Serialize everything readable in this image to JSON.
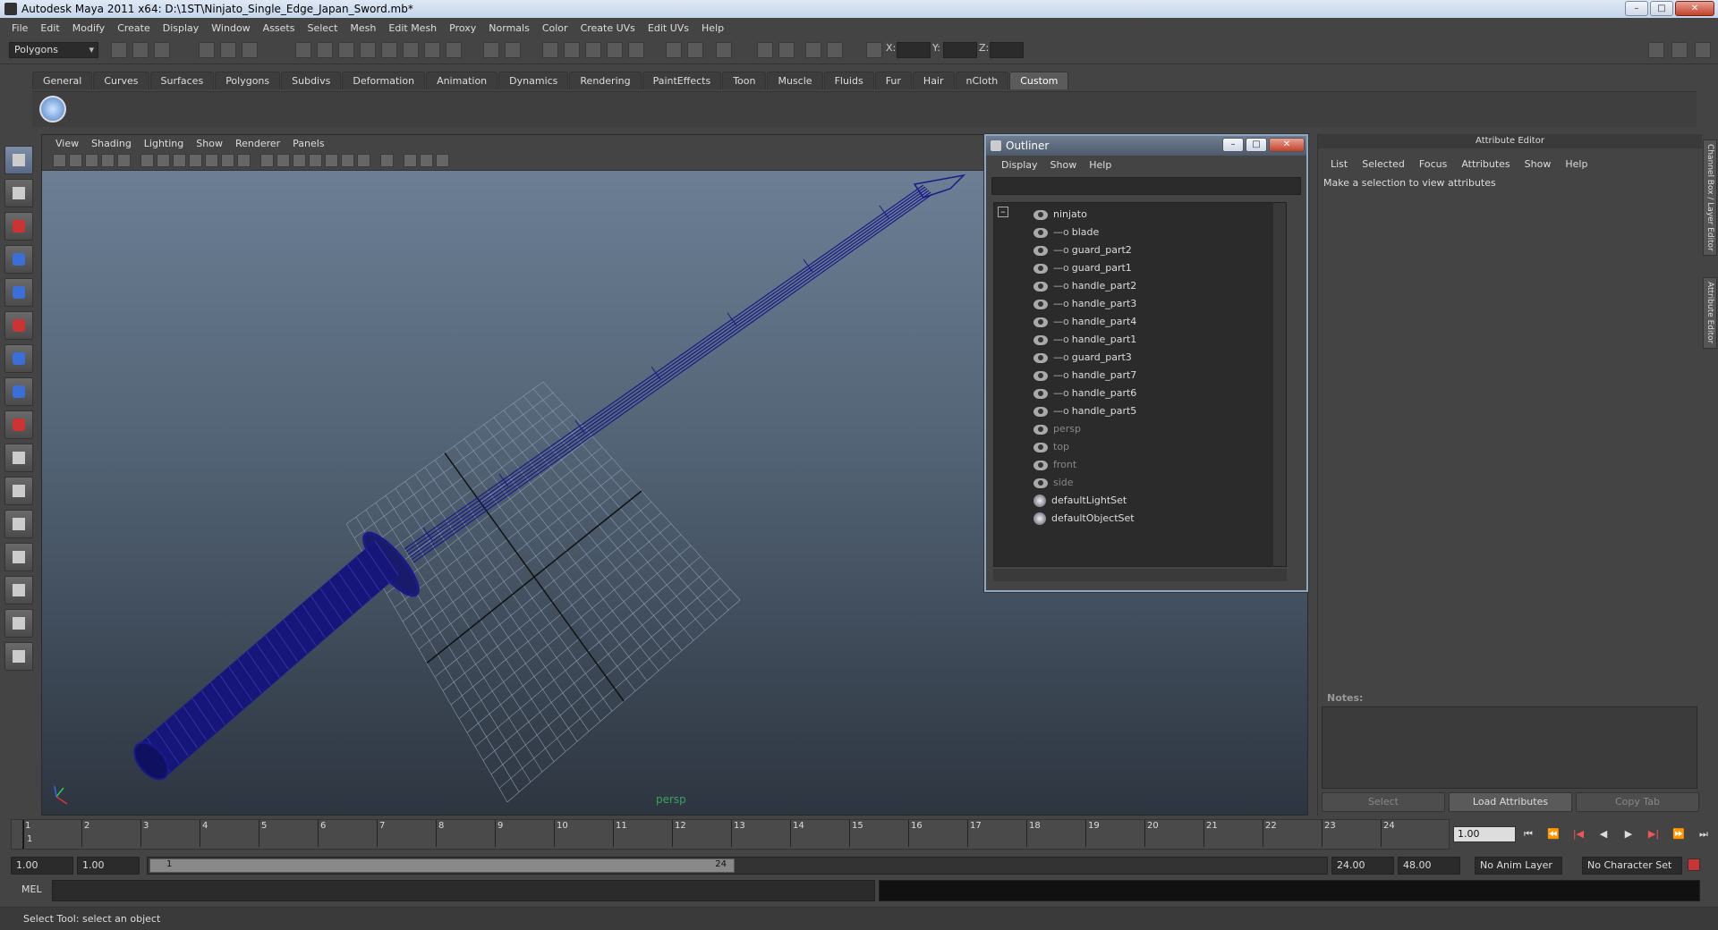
{
  "window": {
    "title": "Autodesk Maya 2011 x64: D:\\1ST\\Ninjato_Single_Edge_Japan_Sword.mb*",
    "minimize": "–",
    "maximize": "□",
    "close": "✕"
  },
  "menubar": [
    "File",
    "Edit",
    "Modify",
    "Create",
    "Display",
    "Window",
    "Assets",
    "Select",
    "Mesh",
    "Edit Mesh",
    "Proxy",
    "Normals",
    "Color",
    "Create UVs",
    "Edit UVs",
    "Help"
  ],
  "statusline": {
    "mode": "Polygons",
    "x_label": "X:",
    "y_label": "Y:",
    "z_label": "Z:"
  },
  "shelf_tabs": [
    "General",
    "Curves",
    "Surfaces",
    "Polygons",
    "Subdivs",
    "Deformation",
    "Animation",
    "Dynamics",
    "Rendering",
    "PaintEffects",
    "Toon",
    "Muscle",
    "Fluids",
    "Fur",
    "Hair",
    "nCloth",
    "Custom"
  ],
  "shelf_active": "Custom",
  "viewport": {
    "menu": [
      "View",
      "Shading",
      "Lighting",
      "Show",
      "Renderer",
      "Panels"
    ],
    "camera": "persp"
  },
  "outliner": {
    "title": "Outliner",
    "menu": [
      "Display",
      "Show",
      "Help"
    ],
    "items": [
      {
        "label": "ninjato",
        "kind": "group",
        "level": 0,
        "dim": false
      },
      {
        "label": "blade",
        "kind": "mesh",
        "level": 1,
        "dim": false
      },
      {
        "label": "guard_part2",
        "kind": "mesh",
        "level": 1,
        "dim": false
      },
      {
        "label": "guard_part1",
        "kind": "mesh",
        "level": 1,
        "dim": false
      },
      {
        "label": "handle_part2",
        "kind": "mesh",
        "level": 1,
        "dim": false
      },
      {
        "label": "handle_part3",
        "kind": "mesh",
        "level": 1,
        "dim": false
      },
      {
        "label": "handle_part4",
        "kind": "mesh",
        "level": 1,
        "dim": false
      },
      {
        "label": "handle_part1",
        "kind": "mesh",
        "level": 1,
        "dim": false
      },
      {
        "label": "guard_part3",
        "kind": "mesh",
        "level": 1,
        "dim": false
      },
      {
        "label": "handle_part7",
        "kind": "mesh",
        "level": 1,
        "dim": false
      },
      {
        "label": "handle_part6",
        "kind": "mesh",
        "level": 1,
        "dim": false
      },
      {
        "label": "handle_part5",
        "kind": "mesh",
        "level": 1,
        "dim": false
      },
      {
        "label": "persp",
        "kind": "camera",
        "level": 0,
        "dim": true
      },
      {
        "label": "top",
        "kind": "camera",
        "level": 0,
        "dim": true
      },
      {
        "label": "front",
        "kind": "camera",
        "level": 0,
        "dim": true
      },
      {
        "label": "side",
        "kind": "camera",
        "level": 0,
        "dim": true
      },
      {
        "label": "defaultLightSet",
        "kind": "set",
        "level": 0,
        "dim": false
      },
      {
        "label": "defaultObjectSet",
        "kind": "set",
        "level": 0,
        "dim": false
      }
    ]
  },
  "attribute_editor": {
    "title": "Attribute Editor",
    "menu": [
      "List",
      "Selected",
      "Focus",
      "Attributes",
      "Show",
      "Help"
    ],
    "hint": "Make a selection to view attributes",
    "notes_label": "Notes:",
    "buttons": {
      "select": "Select",
      "load": "Load Attributes",
      "copy": "Copy Tab"
    }
  },
  "side_tabs": {
    "channel_box": "Channel Box / Layer Editor",
    "attribute_editor": "Attribute Editor"
  },
  "timeline": {
    "ticks": [
      1,
      2,
      3,
      4,
      5,
      6,
      7,
      8,
      9,
      10,
      11,
      12,
      13,
      14,
      15,
      16,
      17,
      18,
      19,
      20,
      21,
      22,
      23,
      24
    ],
    "current_frame_label": "1",
    "current_time": "1.00",
    "playback": [
      "⏮",
      "⏪",
      "|◀",
      "◀",
      "▶",
      "▶|",
      "⏩",
      "⏭"
    ]
  },
  "range": {
    "start": "1.00",
    "playback_start": "1.00",
    "handle_start": "1",
    "handle_end": "24",
    "playback_end": "24.00",
    "end": "48.00",
    "anim_layer": "No Anim Layer",
    "character_set": "No Character Set"
  },
  "command": {
    "label": "MEL"
  },
  "help_line": "Select Tool: select an object",
  "colors": {
    "wireframe": "#1a1a8a",
    "grid": "#8a9ab0",
    "accent": "#5b5b5b"
  }
}
